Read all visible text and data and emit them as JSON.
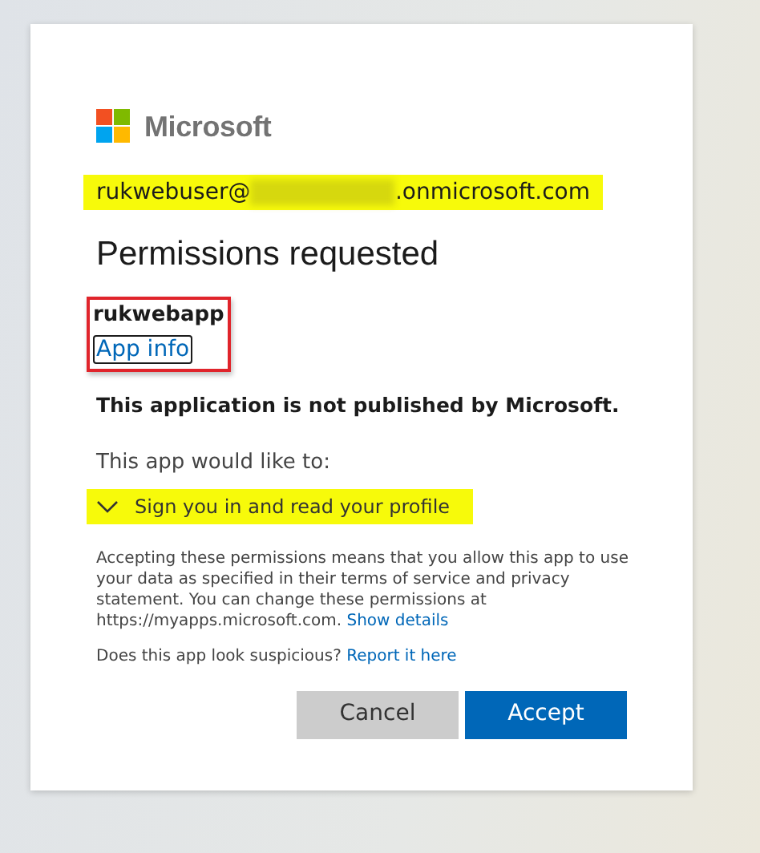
{
  "brand": {
    "name": "Microsoft"
  },
  "account": {
    "prefix": "rukwebuser@",
    "redacted": true,
    "suffix": ".onmicrosoft.com",
    "highlighted": true
  },
  "title": "Permissions requested",
  "app": {
    "name": "rukwebapp",
    "link": "App info",
    "outlined": true
  },
  "publisher_notice": "This application is not published by Microsoft.",
  "intro": "This app would like to:",
  "permissions": [
    {
      "label": "Sign you in and read your profile",
      "expanded": false,
      "highlighted": true
    }
  ],
  "disclaimer": {
    "text": "Accepting these permissions means that you allow this app to use your data as specified in their terms of service and privacy statement. You can change these permissions at https://myapps.microsoft.com.",
    "link": "Show details"
  },
  "report": {
    "text": "Does this app look suspicious?",
    "link": "Report it here"
  },
  "buttons": [
    {
      "label": "Cancel",
      "kind": "secondary"
    },
    {
      "label": "Accept",
      "kind": "primary"
    }
  ]
}
